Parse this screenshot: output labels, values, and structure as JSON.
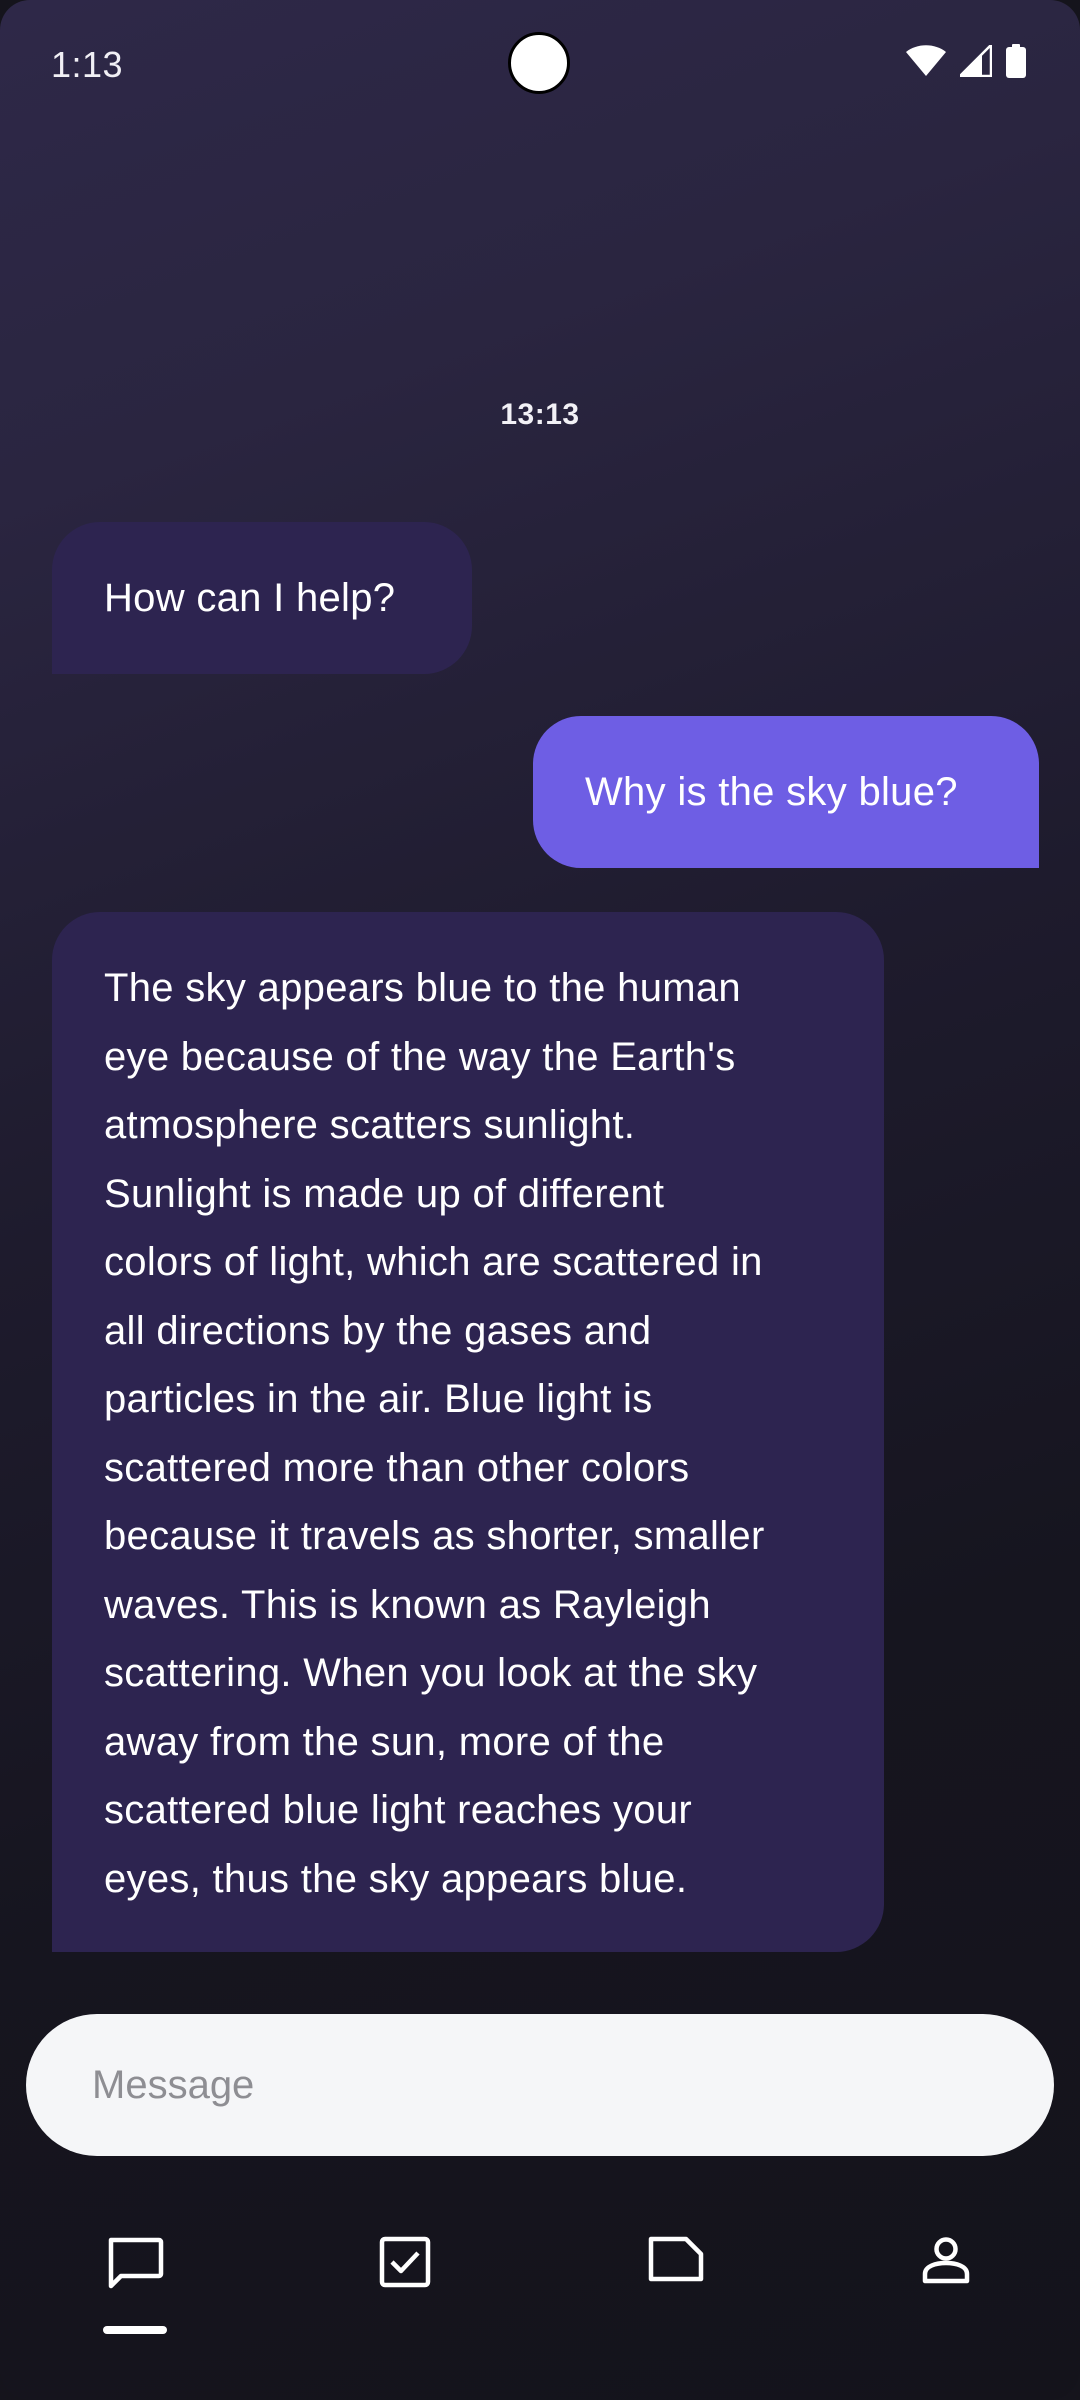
{
  "status_bar": {
    "time": "1:13",
    "icons": [
      "wifi-icon",
      "signal-icon",
      "battery-icon"
    ]
  },
  "conversation": {
    "timestamp": "13:13",
    "messages": [
      {
        "role": "assistant",
        "text": "How can I help?"
      },
      {
        "role": "user",
        "text": "Why is the sky blue?"
      },
      {
        "role": "assistant",
        "lines": [
          "The sky appears blue to the human",
          "eye because of the way the Earth's",
          "atmosphere scatters sunlight.",
          "Sunlight is made up of different",
          "colors of light, which are scattered in",
          "all directions by the gases and",
          "particles in the air. Blue light is",
          "scattered more than other colors",
          "because it travels as shorter, smaller",
          "waves. This is known as Rayleigh",
          "scattering. When you look at the sky",
          "away from the sun, more of the",
          "scattered blue light reaches your",
          "eyes, thus the sky appears blue."
        ]
      }
    ]
  },
  "composer": {
    "value": "",
    "placeholder": "Message"
  },
  "bottom_nav": {
    "items": [
      {
        "icon": "chat-bubble-icon",
        "selected": true
      },
      {
        "icon": "checkbox-icon",
        "selected": false
      },
      {
        "icon": "note-icon",
        "selected": false
      },
      {
        "icon": "person-icon",
        "selected": false
      }
    ]
  },
  "colors": {
    "user_bubble": "#6e5ee4",
    "assistant_bubble": "#2d2450",
    "input_background": "#f5f6f8"
  }
}
